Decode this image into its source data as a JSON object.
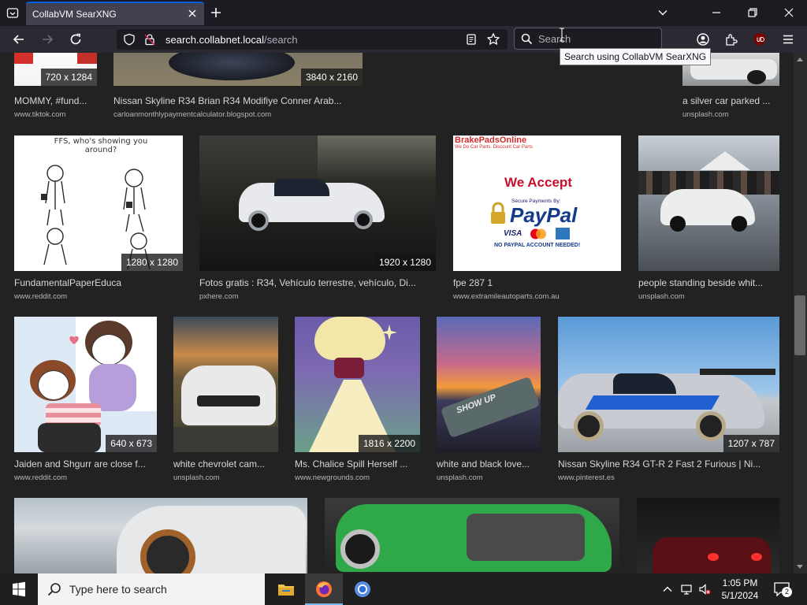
{
  "browser": {
    "tab_title": "CollabVM SearXNG",
    "url_host": "search.collabnet.local",
    "url_path": "/search",
    "search_placeholder": "Search",
    "tooltip": "Search using CollabVM SearXNG"
  },
  "results": [
    {
      "res": "720 x 1284",
      "caption": "MOMMY, #fund...",
      "source": "www.tiktok.com"
    },
    {
      "res": "3840 x 2160",
      "caption": "Nissan Skyline R34 Brian R34 Modifiye Conner Arab...",
      "source": "carloanmonthlypaymentcalculator.blogspot.com"
    },
    {
      "res": "",
      "caption": "a silver car parked ...",
      "source": "unsplash.com"
    },
    {
      "res": "1280 x 1280",
      "caption": "FundamentalPaperEduca",
      "source": "www.reddit.com",
      "text": "FFS, who's showing you around?"
    },
    {
      "res": "1920 x 1280",
      "caption": "Fotos gratis : R34, Vehículo terrestre, vehículo, Di...",
      "source": "pxhere.com"
    },
    {
      "res": "",
      "caption": "fpe 287 1",
      "source": "www.extramileautoparts.com.au",
      "text_brand": "BrakePadsOnline",
      "text_tag": "We Do Car Parts. Discount Car Parts",
      "text_accept": "We Accept",
      "text_secure": "Secure Payments By:",
      "text_paypal": "PayPal",
      "text_cards": "VISA",
      "text_note": "NO PAYPAL ACCOUNT NEEDED!"
    },
    {
      "res": "",
      "caption": "people standing beside whit...",
      "source": "unsplash.com"
    },
    {
      "res": "640 x 673",
      "caption": "Jaiden and Shgurr are close f...",
      "source": "www.reddit.com"
    },
    {
      "res": "",
      "caption": "white chevrolet cam...",
      "source": "unsplash.com"
    },
    {
      "res": "1816 x 2200",
      "caption": "Ms. Chalice Spill Herself ...",
      "source": "www.newgrounds.com"
    },
    {
      "res": "",
      "caption": "white and black love...",
      "source": "unsplash.com",
      "text": "SHOW UP"
    },
    {
      "res": "1207 x 787",
      "caption": "Nissan Skyline R34 GT-R 2 Fast 2 Furious | Ni...",
      "source": "www.pinterest.es"
    }
  ],
  "taskbar": {
    "search_text": "Type here to search",
    "time": "1:05 PM",
    "date": "5/1/2024",
    "notif_count": "2"
  },
  "colors": {
    "accent": "#0060df",
    "content_bg": "#222222"
  }
}
